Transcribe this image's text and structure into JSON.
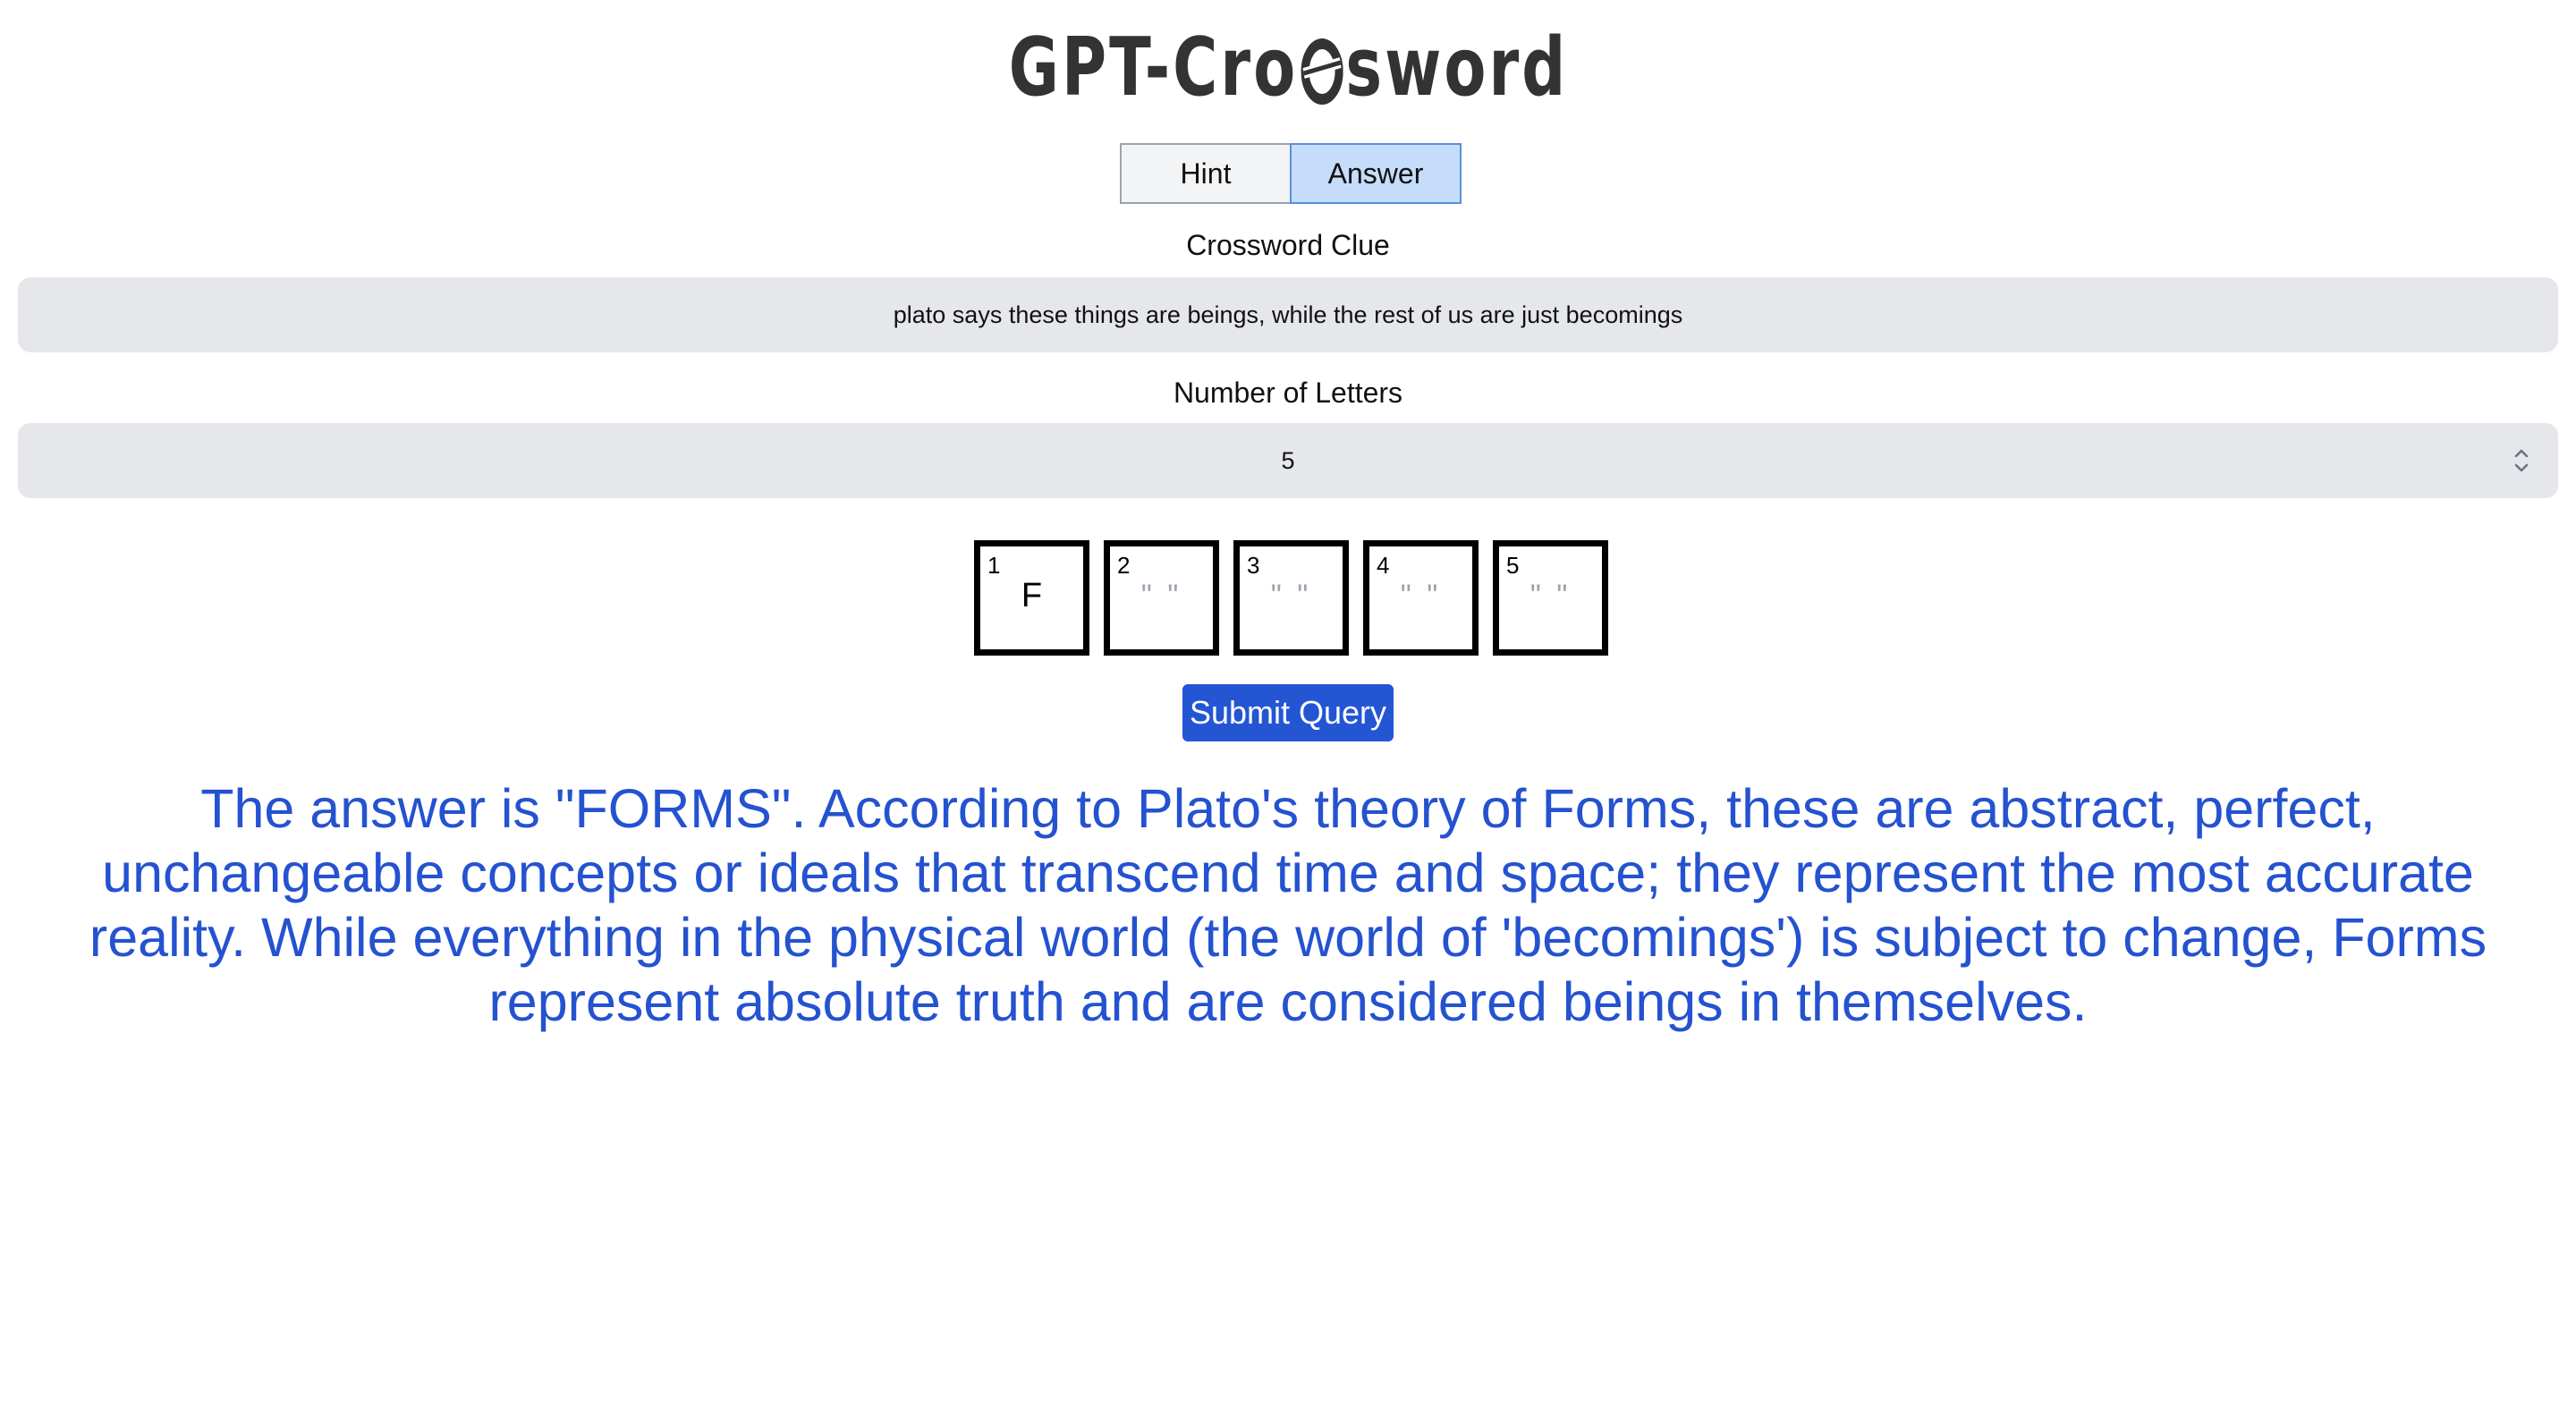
{
  "logo": {
    "text_before": "GPT-Cro",
    "text_after": "sword"
  },
  "toggle": {
    "hint_label": "Hint",
    "answer_label": "Answer",
    "active": "Answer"
  },
  "clue": {
    "label": "Crossword Clue",
    "value": "plato says these things are beings, while the rest of us are just becomings"
  },
  "letters": {
    "label": "Number of Letters",
    "selected": "5"
  },
  "grid": {
    "cells": [
      {
        "number": "1",
        "letter": "F"
      },
      {
        "number": "2",
        "letter": "\" \""
      },
      {
        "number": "3",
        "letter": "\" \""
      },
      {
        "number": "4",
        "letter": "\" \""
      },
      {
        "number": "5",
        "letter": "\" \""
      }
    ]
  },
  "submit_label": "Submit Query",
  "answer": {
    "text": "The answer is \"FORMS\". According to Plato's theory of Forms, these are abstract, perfect, unchangeable concepts or ideals that transcend time and space; they represent the most accurate reality. While everything in the physical world (the world of 'becomings') is subject to change, Forms represent absolute truth and are considered beings in themselves."
  },
  "colors": {
    "answer_text": "#2452d0",
    "submit_bg": "#2456d3",
    "toggle_active_bg": "#c6dcfb",
    "field_bg": "#e5e7eb"
  }
}
